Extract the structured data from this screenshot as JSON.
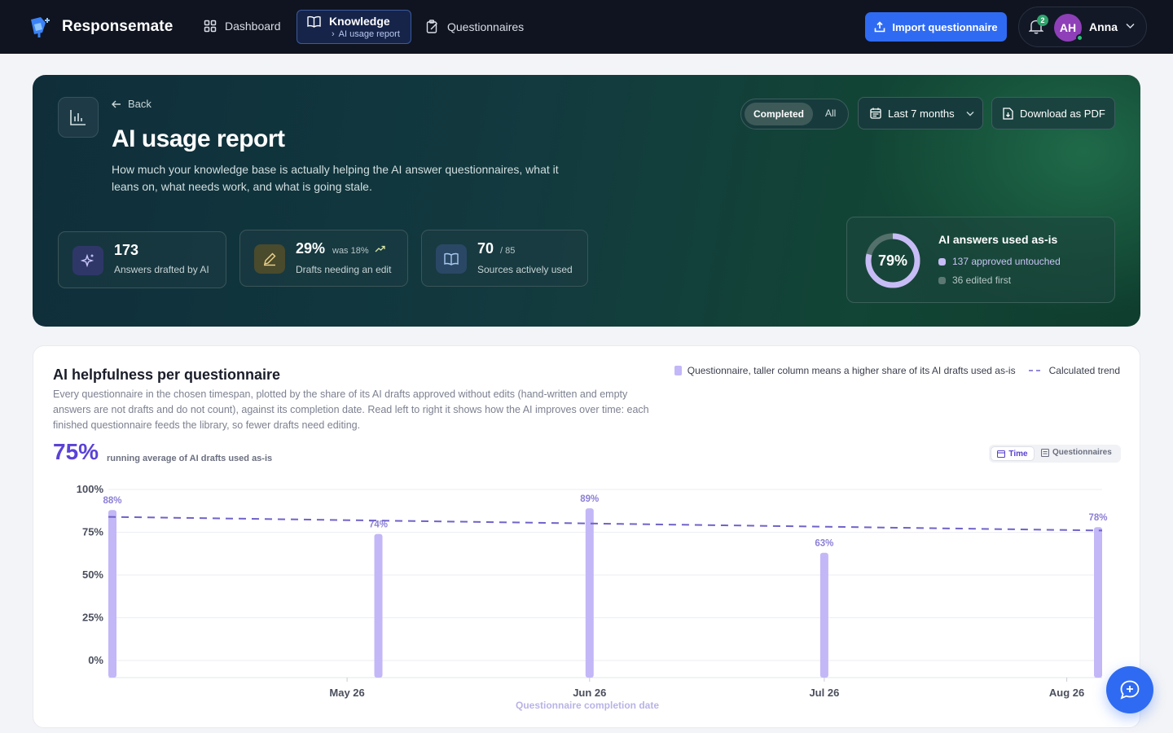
{
  "app": {
    "brand": "Responsemate",
    "nav": {
      "dashboard": "Dashboard",
      "knowledge": "Knowledge",
      "knowledge_sub": "AI usage report",
      "questionnaires": "Questionnaires"
    },
    "import_label": "Import questionnaire",
    "notifications_count": "2",
    "user": {
      "initials": "AH",
      "name": "Anna"
    }
  },
  "hero": {
    "back_label": "Back",
    "title": "AI usage report",
    "description": "How much your knowledge base is actually helping the AI answer questionnaires, what it leans on, what needs work, and what is going stale.",
    "filter": {
      "completed": "Completed",
      "all": "All"
    },
    "range": "Last 7 months",
    "download": "Download as PDF",
    "stats": [
      {
        "value": "173",
        "sub": "",
        "label": "Answers drafted by AI"
      },
      {
        "value": "29%",
        "sub": "was 18%",
        "label": "Drafts needing an edit"
      },
      {
        "value": "70",
        "sub": "/ 85",
        "label": "Sources actively used"
      }
    ],
    "ring": {
      "percent": "79%",
      "fraction": 0.79,
      "title": "AI answers used as-is",
      "approved": "137 approved untouched",
      "edited": "36 edited first"
    }
  },
  "chart": {
    "title": "AI helpfulness per questionnaire",
    "description": "Every questionnaire in the chosen timespan, plotted by the share of its AI drafts approved without edits (hand-written and empty answers are not drafts and do not count), against its completion date. Read left to right it shows how the AI improves over time: each finished questionnaire feeds the library, so fewer drafts need editing.",
    "legend_columns": "Questionnaire, taller column means a higher share of its AI drafts used as-is",
    "legend_trend": "Calculated trend",
    "headline_value": "75%",
    "headline_label": "running average of AI drafts used as-is",
    "toggle": {
      "time": "Time",
      "questionnaires": "Questionnaires"
    },
    "colors": {
      "bar": "#c3b7f7",
      "trend": "#6f63c9",
      "label": "#8b7fd6"
    }
  },
  "chart_data": {
    "type": "bar",
    "title": "AI helpfulness per questionnaire",
    "xlabel": "Questionnaire completion date",
    "ylabel": "",
    "ylim": [
      0,
      100
    ],
    "y_ticks": [
      "100%",
      "75%",
      "50%",
      "25%",
      "0%"
    ],
    "x_ticks": [
      "May 26",
      "Jun 26",
      "Jul 26",
      "Aug 26"
    ],
    "series": [
      {
        "values": [
          88,
          74,
          89,
          63,
          78
        ],
        "x": [
          "2026-04-26",
          "2026-05-30",
          "2026-06-26",
          "2026-07-26",
          "2026-08-30"
        ],
        "labels": [
          "88%",
          "74%",
          "89%",
          "63%",
          "78%"
        ]
      },
      {
        "name": "Calculated trend",
        "style": "dashed",
        "values": [
          84,
          76
        ]
      }
    ],
    "legend": "top-right",
    "grid": true
  }
}
